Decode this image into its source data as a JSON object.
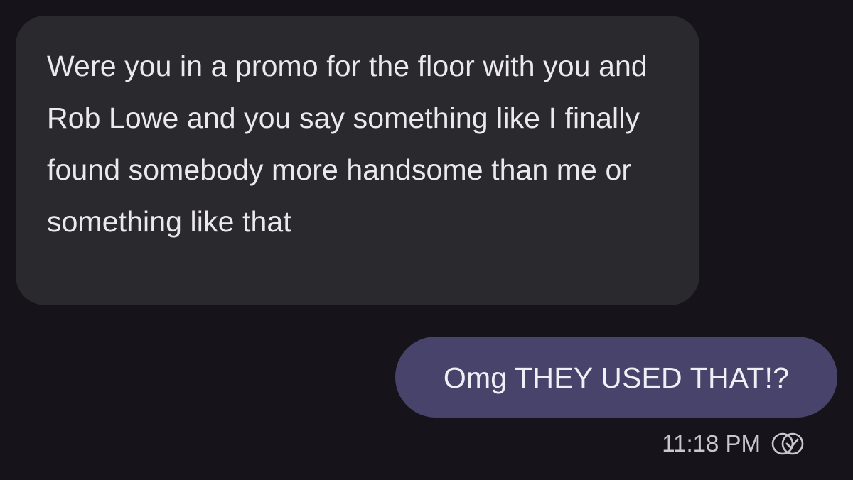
{
  "conversation": {
    "incoming_message": "Were you in a promo for the floor with you and Rob Lowe and you say something like I finally found somebody more handsome than me or something like that",
    "outgoing_message": "Omg THEY USED THAT!?",
    "outgoing_timestamp": "11:18 PM",
    "outgoing_status_icon": "delivered-double-check-icon"
  },
  "colors": {
    "background": "#16141a",
    "incoming_bubble": "#2a292e",
    "outgoing_bubble": "#48436a",
    "text": "#ebe9ee",
    "meta_text": "#c9c6cf"
  }
}
